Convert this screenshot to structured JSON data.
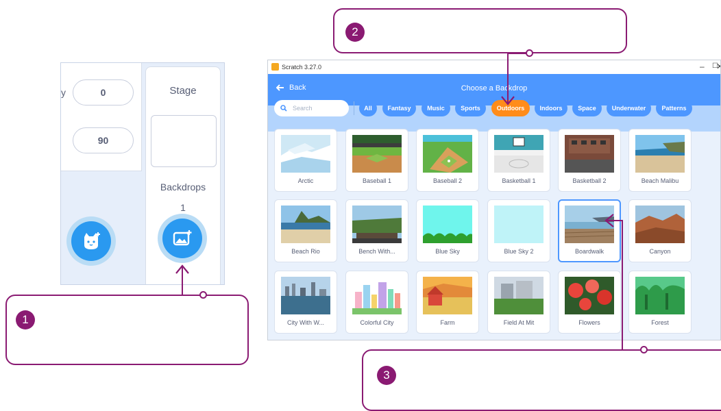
{
  "left_pane": {
    "cut_label": "y",
    "inputs": [
      "0",
      "90"
    ],
    "stage_title": "Stage",
    "backdrops_label": "Backdrops",
    "backdrops_count": "1"
  },
  "callouts": [
    {
      "number": "1"
    },
    {
      "number": "2"
    },
    {
      "number": "3"
    }
  ],
  "window": {
    "title": "Scratch 3.27.0",
    "controls": [
      "–",
      "☐",
      "✕"
    ],
    "back_label": "Back",
    "header_title": "Choose a Backdrop",
    "search_placeholder": "Search",
    "tags": [
      "All",
      "Fantasy",
      "Music",
      "Sports",
      "Outdoors",
      "Indoors",
      "Space",
      "Underwater",
      "Patterns"
    ],
    "active_tag": "Outdoors",
    "selected_item": "Boardwalk",
    "items": [
      "Arctic",
      "Baseball 1",
      "Baseball 2",
      "Basketball 1",
      "Basketball 2",
      "Beach Malibu",
      "Beach Rio",
      "Bench With...",
      "Blue Sky",
      "Blue Sky 2",
      "Boardwalk",
      "Canyon",
      "City With W...",
      "Colorful City",
      "Farm",
      "Field At Mit",
      "Flowers",
      "Forest"
    ]
  },
  "colors": {
    "accent_blue": "#4d97ff",
    "active_orange": "#ff8c1a",
    "callout_magenta": "#8a1a72"
  }
}
